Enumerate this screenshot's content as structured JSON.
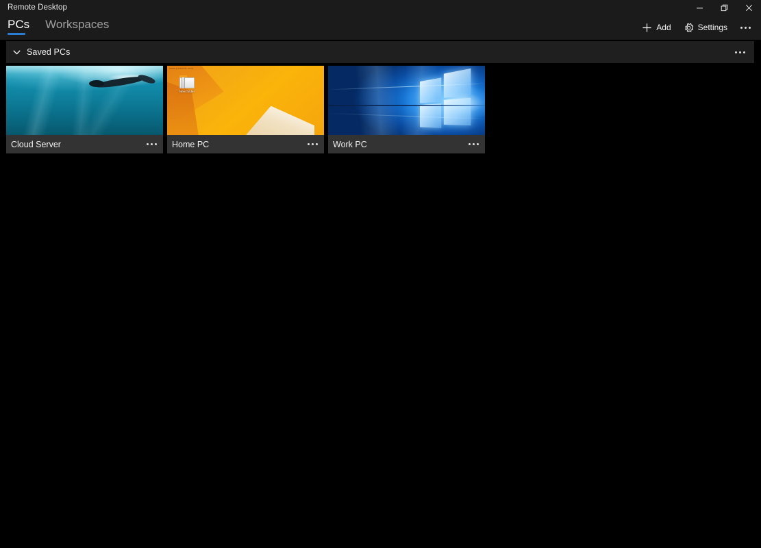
{
  "window": {
    "title": "Remote Desktop",
    "controls": {
      "minimize": "minimize",
      "restore": "restore",
      "close": "close"
    }
  },
  "commandbar": {
    "tabs": [
      {
        "label": "PCs",
        "selected": true
      },
      {
        "label": "Workspaces",
        "selected": false
      }
    ],
    "actions": {
      "add_label": "Add",
      "settings_label": "Settings",
      "more_label": "See more"
    }
  },
  "groups": [
    {
      "title": "Saved PCs",
      "expanded": true,
      "more_label": "More options",
      "tiles": [
        {
          "name": "Cloud Server",
          "thumbnail": "underwater-diver-photo",
          "more_label": "More options"
        },
        {
          "name": "Home PC",
          "thumbnail": "orange-desktop-screenshot",
          "desktop_icon_label": "New folder",
          "desktop_watermark": "www.pcworld.com",
          "more_label": "More options"
        },
        {
          "name": "Work PC",
          "thumbnail": "windows-10-hero-wallpaper",
          "more_label": "More options"
        }
      ]
    }
  ],
  "colors": {
    "accent": "#2b7cd3",
    "titlebar_bg": "#1b1b1b",
    "content_bg": "#000000",
    "group_header_bg": "#1f1f1f",
    "tile_bg": "#333333",
    "text_primary": "#ffffff",
    "text_secondary": "#a0a0a0"
  }
}
